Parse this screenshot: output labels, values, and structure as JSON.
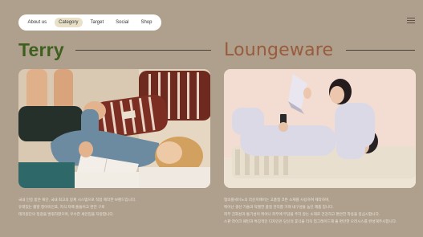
{
  "nav": {
    "items": [
      "About us",
      "Category",
      "Target",
      "Social",
      "Shop"
    ],
    "active_index": 1
  },
  "menu": {
    "icon": "hamburger-menu-icon"
  },
  "sections": [
    {
      "title": "Terry",
      "color": "#3f5f1f",
      "photo_alt": "Woman reading a book lying on striped pillows",
      "caption": [
        "국내 인증 받은 재단, 국내 최고의 봉제 시스템으로 직접 제작한 브랜드입니다.",
        "유래있는 활발 청아미인포, 지식 자백 플들어고 완전 구로",
        "테리원단의 정갈을 발휘하였으며, 우수한 세안입을 자랑합니다."
      ]
    },
    {
      "title": "Loungeware",
      "color": "#9a5b3d",
      "photo_alt": "Couple in loungewear relaxing on a sofa reading",
      "caption": [
        "협의를세이노의 라운지웨어는 고품질 코튼 소재를 사용하여 제작하며,",
        "뛰어난 생산 기술과 탁월한 품질 관리를 거쳐 내구성을 높인 제품 입니다.",
        "피부 친화성과 통기성이 뛰어나 피부에 부담을 주지 않는 소재로 건강하고 편안한 착용을 중심시합니다.",
        "스판 라이크 패턴과 특징적인 디자인은 당신의 휴식을 더욱 업그레이드해 줄 편안한 오러시스를 완성해주시합니다."
      ]
    }
  ]
}
